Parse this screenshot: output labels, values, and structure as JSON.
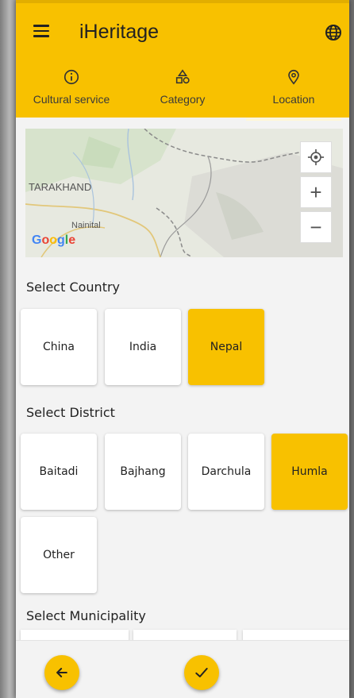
{
  "app": {
    "title": "iHeritage"
  },
  "tabs": [
    {
      "label": "Cultural service",
      "icon": "info-icon"
    },
    {
      "label": "Category",
      "icon": "shapes-icon"
    },
    {
      "label": "Location",
      "icon": "location-pin-icon",
      "active": true
    }
  ],
  "map": {
    "labels": {
      "region": "TARAKHAND",
      "city": "Nainital"
    },
    "attribution": "Google",
    "controls": {
      "zoom_in": "+",
      "zoom_out": "−"
    }
  },
  "country": {
    "heading": "Select Country",
    "options": [
      "China",
      "India",
      "Nepal"
    ],
    "selected": "Nepal"
  },
  "district": {
    "heading": "Select District",
    "options": [
      "Baitadi",
      "Bajhang",
      "Darchula",
      "Humla",
      "Other"
    ],
    "selected": "Humla"
  },
  "municipality": {
    "heading": "Select Municipality"
  },
  "colors": {
    "accent": "#f8c100",
    "background": "#f3f3f3",
    "card": "#ffffff"
  }
}
